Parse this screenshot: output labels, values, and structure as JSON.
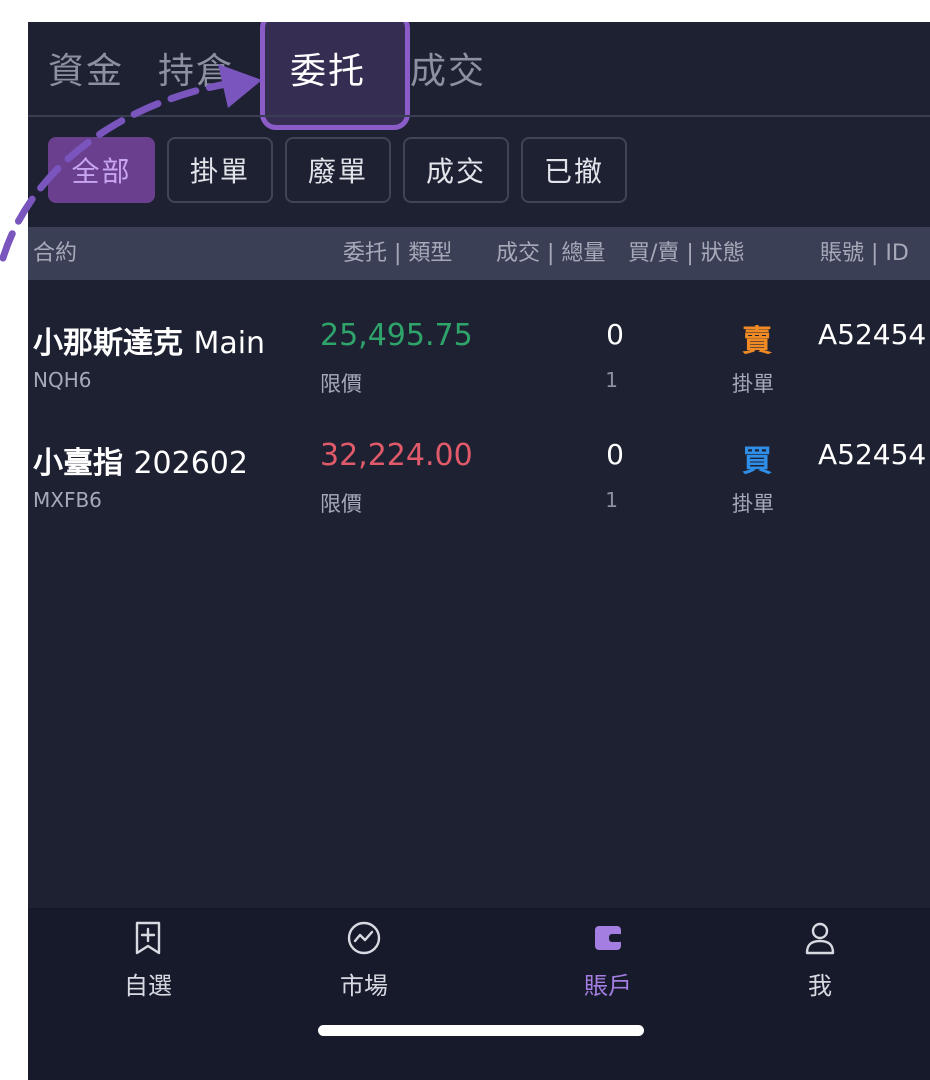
{
  "tabs": [
    {
      "label": "資金",
      "active": false
    },
    {
      "label": "持倉",
      "active": false
    },
    {
      "label": "委托",
      "active": true
    },
    {
      "label": "成交",
      "active": false
    }
  ],
  "filters": [
    {
      "label": "全部",
      "active": true
    },
    {
      "label": "掛單",
      "active": false
    },
    {
      "label": "廢單",
      "active": false
    },
    {
      "label": "成交",
      "active": false
    },
    {
      "label": "已撤",
      "active": false
    }
  ],
  "columns": {
    "contract": "合約",
    "order_type": "委托 | 類型",
    "filled_total": "成交 | 總量",
    "side_status": "買/賣 | 狀態",
    "account": "賬號 | ID"
  },
  "orders": [
    {
      "name": "小那斯達克",
      "name_suffix": "Main",
      "code": "NQH6",
      "price": "25,495.75",
      "type": "限價",
      "filled": "0",
      "total": "1",
      "side": "賣",
      "status": "掛單",
      "account": "A52454"
    },
    {
      "name": "小臺指",
      "name_suffix": "202602",
      "code": "MXFB6",
      "price": "32,224.00",
      "type": "限價",
      "filled": "0",
      "total": "1",
      "side": "買",
      "status": "掛單",
      "account": "A52454"
    }
  ],
  "bottom_nav": [
    {
      "label": "自選",
      "icon": "bookmark-add-icon",
      "active": false
    },
    {
      "label": "市場",
      "icon": "market-trend-icon",
      "active": false
    },
    {
      "label": "賬戶",
      "icon": "wallet-icon",
      "active": true
    },
    {
      "label": "我",
      "icon": "person-icon",
      "active": false
    }
  ],
  "colors": {
    "background": "#1e2132",
    "accent": "#a47ee0",
    "price_up": "#2ea36a",
    "price_down": "#e05a6a",
    "sell": "#f08a24",
    "buy": "#2f8fe8",
    "highlight": "#8b5cc8"
  }
}
